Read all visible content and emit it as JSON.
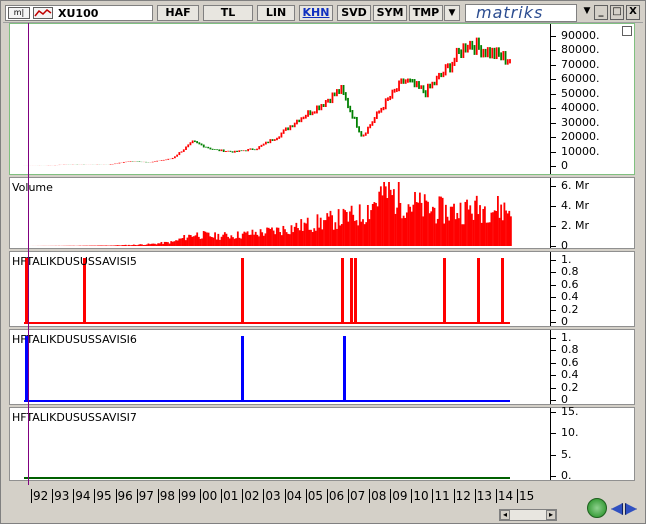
{
  "toolbar": {
    "symbol": "XU100",
    "buttons": [
      "HAF",
      "TL",
      "LIN",
      "KHN",
      "SVD",
      "SYM",
      "TMP"
    ],
    "active": "KHN",
    "logo": "matriks",
    "minimize": "_",
    "restore": "□",
    "close": "X"
  },
  "panels": {
    "price": {
      "title": "",
      "ticks": [
        "90000.",
        "80000.",
        "70000.",
        "60000.",
        "50000.",
        "40000.",
        "30000.",
        "20000.",
        "10000.",
        "0"
      ]
    },
    "volume": {
      "title": "Volume",
      "ticks": [
        "6. Mr",
        "4. Mr",
        "2. Mr",
        "0"
      ]
    },
    "ind5": {
      "title": "HFTALIKDUSUSSAVISI5",
      "ticks": [
        "1.",
        "0.8",
        "0.6",
        "0.4",
        "0.2",
        "0"
      ]
    },
    "ind6": {
      "title": "HFTALIKDUSUSSAVISI6",
      "ticks": [
        "1.",
        "0.8",
        "0.6",
        "0.4",
        "0.2",
        "0"
      ]
    },
    "ind7": {
      "title": "HFTALIKDUSUSSAVISI7",
      "ticks": [
        "15.",
        "10.",
        "5.",
        "0."
      ]
    }
  },
  "xaxis": {
    "years": [
      "92",
      "93",
      "94",
      "95",
      "96",
      "97",
      "98",
      "99",
      "00",
      "01",
      "02",
      "03",
      "04",
      "05",
      "06",
      "07",
      "08",
      "09",
      "10",
      "11",
      "12",
      "13",
      "14",
      "15"
    ]
  },
  "colors": {
    "up": "#ff0000",
    "down": "#008000",
    "ind5": "#ff0000",
    "ind6": "#0000ff",
    "ind7": "#006000",
    "cursor": "#800080"
  },
  "chart_data": [
    {
      "type": "line",
      "title": "XU100",
      "x": [
        "92",
        "93",
        "94",
        "95",
        "96",
        "97",
        "98",
        "99",
        "00",
        "01",
        "02",
        "03",
        "04",
        "05",
        "06",
        "07",
        "08",
        "09",
        "10",
        "11",
        "12",
        "13",
        "14",
        "15"
      ],
      "values": [
        400,
        450,
        1000,
        900,
        1000,
        3500,
        2800,
        5500,
        18000,
        12000,
        10500,
        13000,
        22000,
        35000,
        45000,
        57000,
        22000,
        45000,
        64000,
        55000,
        72000,
        92000,
        85000,
        79000
      ],
      "ylim": [
        0,
        100000
      ]
    },
    {
      "type": "bar",
      "title": "Volume",
      "x": [
        "92",
        "93",
        "94",
        "95",
        "96",
        "97",
        "98",
        "99",
        "00",
        "01",
        "02",
        "03",
        "04",
        "05",
        "06",
        "07",
        "08",
        "09",
        "10",
        "11",
        "12",
        "13",
        "14",
        "15"
      ],
      "values": [
        0.0,
        0.01,
        0.02,
        0.03,
        0.05,
        0.1,
        0.2,
        0.4,
        1.2,
        1.0,
        1.1,
        1.3,
        1.6,
        2.0,
        2.4,
        2.8,
        3.2,
        5.5,
        4.5,
        3.8,
        3.5,
        3.7,
        3.9,
        3.6
      ],
      "ylim": [
        0,
        6.5
      ],
      "unit": "Mr"
    },
    {
      "type": "bar",
      "title": "HFTALIKDUSUSSAVISI5",
      "x": [
        "92",
        "94",
        "02",
        "08",
        "08",
        "08",
        "13",
        "14",
        "15"
      ],
      "values": [
        1,
        1,
        1,
        1,
        1,
        1,
        1,
        1,
        1
      ],
      "ylim": [
        0,
        1
      ]
    },
    {
      "type": "bar",
      "title": "HFTALIKDUSUSSAVISI6",
      "x": [
        "92",
        "02",
        "08"
      ],
      "values": [
        1,
        1,
        1
      ],
      "ylim": [
        0,
        1
      ]
    },
    {
      "type": "line",
      "title": "HFTALIKDUSUSSAVISI7",
      "values": [
        0
      ],
      "ylim": [
        0,
        15
      ]
    }
  ]
}
